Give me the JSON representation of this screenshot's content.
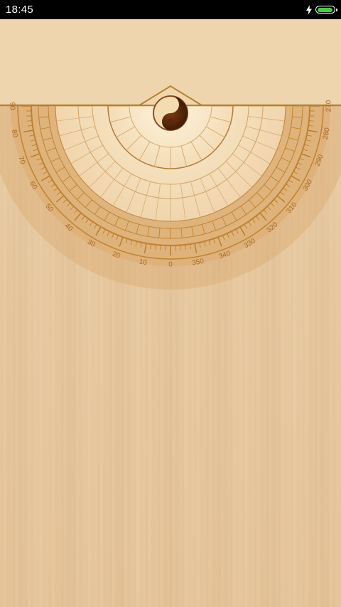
{
  "status_bar": {
    "time": "18:45",
    "battery_level": 0.95,
    "charging": true,
    "icons": [
      "charging-bolt-icon",
      "battery-icon"
    ],
    "colors": {
      "battery_fill": "#3dd13d"
    }
  },
  "compass": {
    "degree_labels": [
      "0",
      "10",
      "20",
      "30",
      "40",
      "50",
      "60",
      "70",
      "80",
      "90",
      "270",
      "280",
      "290",
      "300",
      "310",
      "320",
      "330",
      "340",
      "350"
    ],
    "center_icon": "yin-yang-icon"
  },
  "colors": {
    "wood": "#e8c9a0",
    "ring_accent": "#c0822e",
    "rim": "#b8822f"
  }
}
